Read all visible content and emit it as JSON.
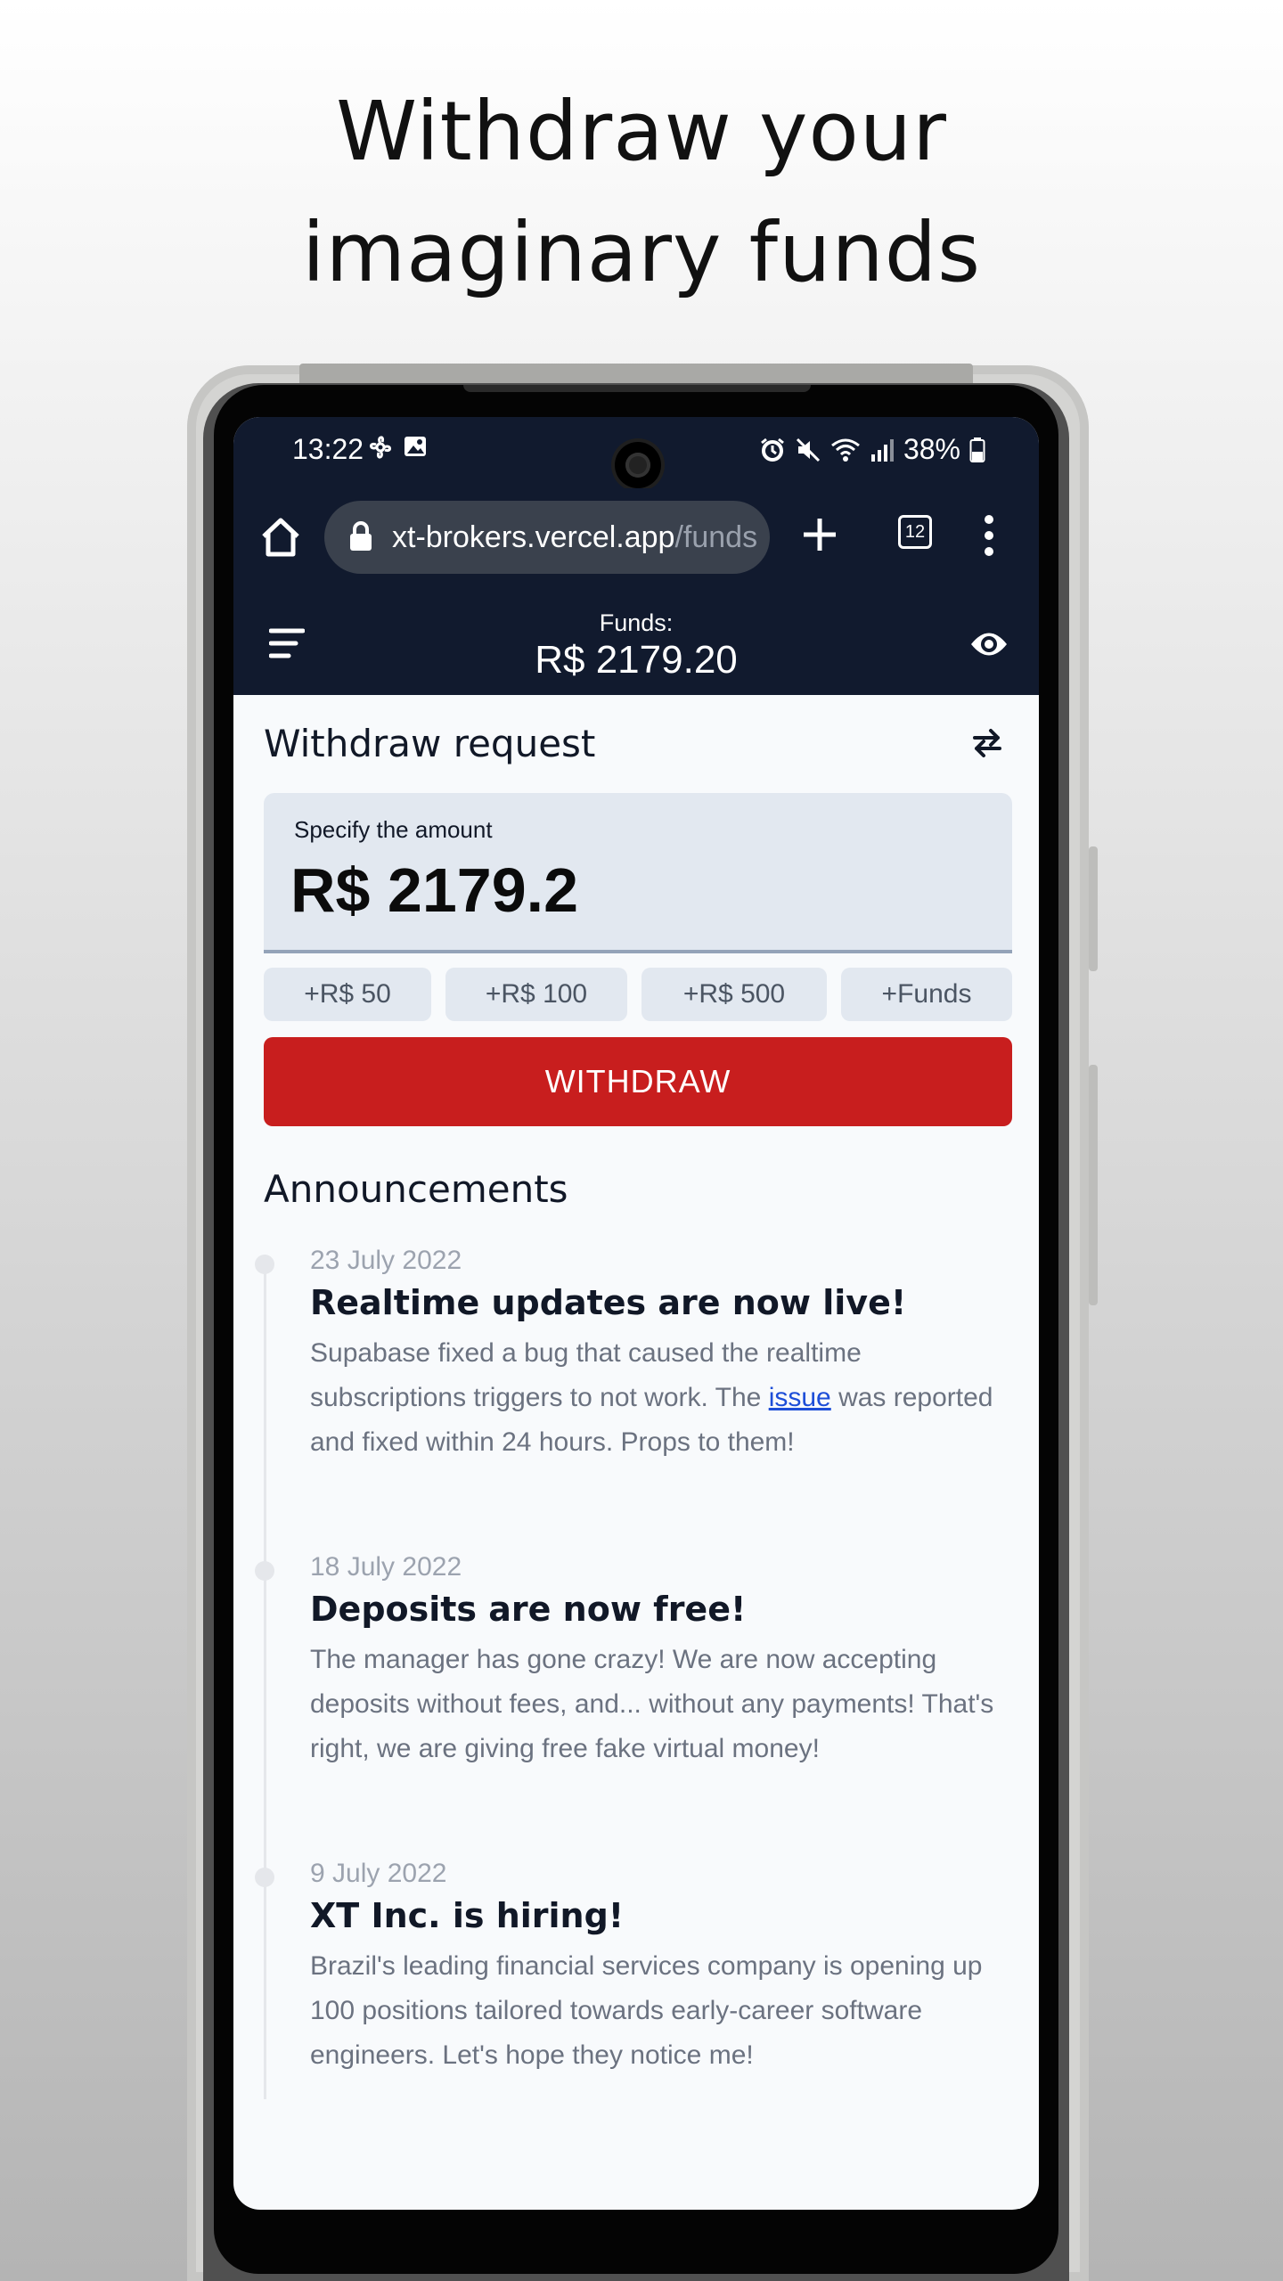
{
  "headline": {
    "line1": "Withdraw your",
    "line2": "imaginary funds"
  },
  "status_bar": {
    "time": "13:22",
    "battery": "38%"
  },
  "browser": {
    "url_host": "xt-brokers.vercel.app",
    "url_path": "/funds",
    "tab_count": "12"
  },
  "header": {
    "funds_label": "Funds:",
    "funds_value": "R$ 2179.20"
  },
  "withdraw": {
    "title": "Withdraw request",
    "amount_label": "Specify the amount",
    "amount_value": "R$ 2179.2",
    "quick_buttons": [
      "+R$ 50",
      "+R$ 100",
      "+R$ 500",
      "+Funds"
    ],
    "submit_label": "WITHDRAW"
  },
  "announcements": {
    "title": "Announcements",
    "items": [
      {
        "date": "23 July 2022",
        "title": "Realtime updates are now live!",
        "body_before": "Supabase fixed a bug that caused the realtime subscriptions triggers to not work. The ",
        "link_text": "issue",
        "body_after": " was reported and fixed within 24 hours. Props to them!"
      },
      {
        "date": "18 July 2022",
        "title": "Deposits are now free!",
        "body": "The manager has gone crazy! We are now accepting deposits without fees, and... without any payments! That's right, we are giving free fake virtual money!"
      },
      {
        "date": "9 July 2022",
        "title": "XT Inc. is hiring!",
        "body": "Brazil's leading financial services company is opening up 100 positions tailored towards early-career software engineers. Let's hope they notice me!"
      }
    ]
  },
  "colors": {
    "navy": "#111a2e",
    "accent_red": "#c81e1e",
    "card_bg": "#e2e8f0"
  },
  "icons": [
    "home-icon",
    "lock-icon",
    "plus-icon",
    "tabs-icon",
    "more-vert-icon",
    "hamburger-menu-icon",
    "eye-icon",
    "swap-arrows-icon",
    "alarm-icon",
    "mute-icon",
    "wifi-icon",
    "signal-icon",
    "battery-icon",
    "fan-icon",
    "image-icon"
  ]
}
